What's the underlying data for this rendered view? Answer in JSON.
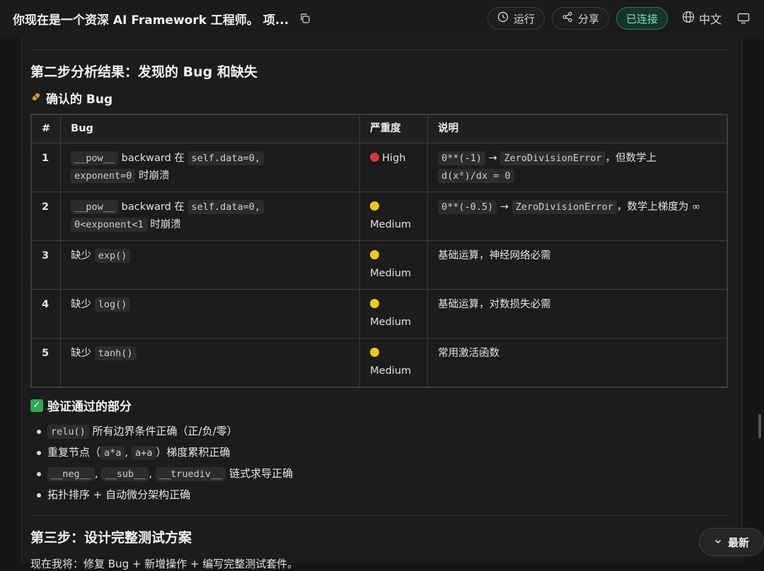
{
  "header": {
    "title": "你现在是一个资深 AI Framework 工程师。 项...",
    "run_label": "运行",
    "share_label": "分享",
    "status_label": "已连接",
    "lang_label": "中文"
  },
  "section2": {
    "heading": "第二步分析结果：发现的 Bug 和缺失",
    "confirmed_heading": "确认的 Bug",
    "table": {
      "headers": [
        "#",
        "Bug",
        "严重度",
        "说明"
      ],
      "rows": [
        {
          "num": "1",
          "bug_code1": "__pow__",
          "bug_text1": " backward 在 ",
          "bug_code2": "self.data=0,",
          "bug_code3": "exponent=0",
          "bug_text2": " 时崩溃",
          "severity": "High",
          "desc_code1": "0**(-1)",
          "desc_arrow": " → ",
          "desc_code2": "ZeroDivisionError",
          "desc_text": "，但数学上 ",
          "desc_code3": "d(x⁰)/dx = 0"
        },
        {
          "num": "2",
          "bug_code1": "__pow__",
          "bug_text1": " backward 在 ",
          "bug_code2": "self.data=0,",
          "bug_code3": "0<exponent<1",
          "bug_text2": " 时崩溃",
          "severity": "Medium",
          "desc_code1": "0**(-0.5)",
          "desc_arrow": " → ",
          "desc_code2": "ZeroDivisionError",
          "desc_text": "，数学上梯度为 ∞"
        },
        {
          "num": "3",
          "bug_text": "缺少 ",
          "bug_code": "exp()",
          "severity": "Medium",
          "desc": "基础运算，神经网络必需"
        },
        {
          "num": "4",
          "bug_text": "缺少 ",
          "bug_code": "log()",
          "severity": "Medium",
          "desc": "基础运算，对数损失必需"
        },
        {
          "num": "5",
          "bug_text": "缺少 ",
          "bug_code": "tanh()",
          "severity": "Medium",
          "desc": "常用激活函数"
        }
      ]
    },
    "verified_heading": "验证通过的部分",
    "verified_items": {
      "i1_code": "relu()",
      "i1_text": " 所有边界条件正确（正/负/零）",
      "i2_text_a": "重复节点（",
      "i2_code_a": "a*a",
      "i2_sep": ", ",
      "i2_code_b": "a+a",
      "i2_text_b": "）梯度累积正确",
      "i3_code_a": "__neg__",
      "i3_code_b": "__sub__",
      "i3_code_c": "__truediv__",
      "i3_sep": ", ",
      "i3_text": " 链式求导正确",
      "i4_text": "拓扑排序 + 自动微分架构正确"
    }
  },
  "section3": {
    "heading": "第三步：设计完整测试方案",
    "body": "现在我将：修复 Bug + 新增操作 + 编写完整测试套件。"
  },
  "latest_button": "最新",
  "colors": {
    "connected_bg": "#15352b",
    "connected_text": "#7fe0b5",
    "high": "#d9363e",
    "medium": "#f5c518",
    "check": "#2fa84f"
  }
}
